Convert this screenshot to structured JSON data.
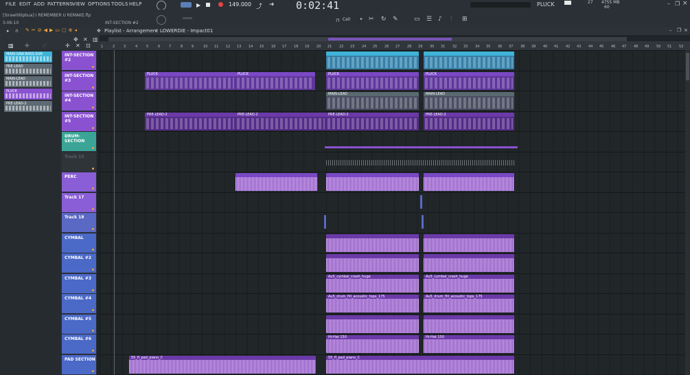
{
  "menu": [
    "FILE",
    "EDIT",
    "ADD",
    "PATTERNS",
    "VIEW",
    "OPTIONS",
    "TOOLS",
    "HELP"
  ],
  "project": {
    "name": "[Sirawit6lpbua] I REMEMBER U REMAKE.flp",
    "time": "5:06:10",
    "hint": "INT-SECTION #2"
  },
  "transport": {
    "tempo": "149.000",
    "clock": "0:02:41",
    "snap": "Cell"
  },
  "channel": {
    "name": "PLUCK",
    "cpu": "27",
    "memory": "4755 MB",
    "voices": "60"
  },
  "playlist": {
    "label": "Playlist - Arrangement",
    "crumb_sep": "›",
    "pattern": "LOWERDIE - Impact01"
  },
  "browser_patterns": [
    {
      "name": "MAIN-SAW-BASS-SUB",
      "color": "#3fb3d8"
    },
    {
      "name": "PRE-LEAD",
      "color": "#5e6a74"
    },
    {
      "name": "MAIN-LEAD",
      "color": "#5e6a74"
    },
    {
      "name": "PLUCK",
      "color": "#8a52d1"
    },
    {
      "name": "PRE-LEAD-2",
      "color": "#5e6a74"
    }
  ],
  "ruler": [
    "1",
    "2",
    "3",
    "4",
    "5",
    "6",
    "7",
    "8",
    "9",
    "10",
    "11",
    "12",
    "13",
    "14",
    "15",
    "16",
    "17",
    "18",
    "19",
    "20",
    "21",
    "22",
    "23",
    "24",
    "25",
    "26",
    "27",
    "28",
    "29",
    "30",
    "31",
    "32",
    "33",
    "34",
    "35",
    "36",
    "37",
    "38",
    "39",
    "40",
    "41",
    "42",
    "43",
    "44",
    "45",
    "46",
    "47",
    "48",
    "49",
    "50",
    "51",
    "52"
  ],
  "tracks": [
    {
      "name": "INT-SECTION #2",
      "color": "#8a52d1"
    },
    {
      "name": "INT-SECTION #3",
      "color": "#8a52d1"
    },
    {
      "name": "INT-SECTION #4",
      "color": "#8a52d1"
    },
    {
      "name": "INT-SECTION #5",
      "color": "#8a52d1"
    },
    {
      "name": "DRUM-SECTION",
      "color": "#3aa596"
    },
    {
      "name": "Track 15",
      "color": "#2e3438"
    },
    {
      "name": "PERC",
      "color": "#8a5ed6"
    },
    {
      "name": "Track 17",
      "color": "#8a5ed6"
    },
    {
      "name": "Track 18",
      "color": "#5a69c4"
    },
    {
      "name": "CYMBAL",
      "color": "#4b69c7"
    },
    {
      "name": "CYMBAL #2",
      "color": "#4b69c7"
    },
    {
      "name": "CYMBAL #3",
      "color": "#4b69c7"
    },
    {
      "name": "CYMBAL #4",
      "color": "#4b69c7"
    },
    {
      "name": "CYMBAL #5",
      "color": "#4b69c7"
    },
    {
      "name": "CYMBAL #6",
      "color": "#4b69c7"
    },
    {
      "name": "PAD SECTION",
      "color": "#4b69c7"
    }
  ],
  "clips": {
    "int2_a": "",
    "int2_b": "MA...SUB",
    "int2_c": "",
    "int2_d": "MA...SUB",
    "pluck_1": "PLUCK",
    "pluck_2": "PLUCK",
    "pluck_3": "PLUCK",
    "pluck_4": "PLUCK",
    "mainlead_1": "MAIN-LEAD",
    "mainlead_2": "MAIN-LEAD",
    "prelead2_1": "PRE-LEAD-2",
    "prelead2_2": "PRE-LEAD-2",
    "prelead2_3": "PRE-LEAD-2",
    "prelead2_4": "PRE-LEAD-2",
    "crash_1": "Au5_cymbal_crash_huge",
    "crash_2": "Au5_cymbal_crash_huge",
    "fill_1": "Au5_drum_fill_acoustic_tops_175",
    "fill_2": "Au5_drum_fill_acoustic_tops_175",
    "hihat_1": "Hi-Hat 150",
    "hihat_2": "Hi-Hat 150",
    "pad_1": "55_fl_pad_piano_C",
    "pad_2": "55_fl_pad_piano_C"
  },
  "colors": {
    "accent": "#8a52d1",
    "cyan": "#3fb3d8",
    "teal": "#3aa596",
    "blue": "#4b69c7"
  }
}
